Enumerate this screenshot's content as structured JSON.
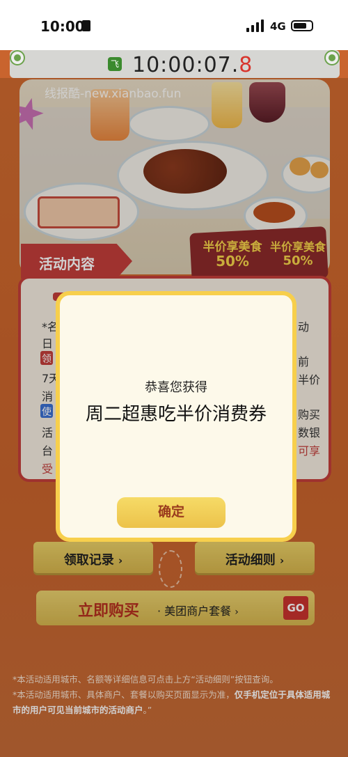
{
  "status_bar": {
    "time": "10:00",
    "network": "4G"
  },
  "clock": {
    "time_main": "10:00:07.",
    "time_frac": "8"
  },
  "watermark": "线报酷-new.xianbao.fun",
  "hero": {
    "section_title": "活动内容",
    "promo_a": {
      "line1": "半价享美食",
      "line2": "50%"
    },
    "promo_b": {
      "line1": "半价享美食",
      "line2": "50%"
    }
  },
  "card_fragments": {
    "left": [
      "*名",
      "日",
      "领",
      "7天",
      "消",
      "使",
      "活",
      "台",
      "受"
    ],
    "right": [
      "动",
      "前",
      "半价",
      "购买",
      "数银",
      "可享"
    ]
  },
  "modal": {
    "subtitle": "恭喜您获得",
    "title": "周二超惠吃半价消费券",
    "confirm_label": "确定"
  },
  "buttons": {
    "records": "领取记录",
    "rules": "活动细则",
    "buy_now": "立即购买",
    "buy_sub": "· 美团商户套餐",
    "go": "GO",
    "arrow": "›"
  },
  "notes": {
    "line1": "*本活动适用城市、名额等详细信息可点击上方“活动细则”按钮查询。",
    "line2_plain": "*本活动适用城市、具体商户、套餐以购买页面显示为准，",
    "line2_bold": "仅手机定位于具体适用城市的用户可见当前城市的活动商户",
    "line2_end": "。”"
  },
  "colors": {
    "accent_red": "#c23d3a",
    "gold": "#f7cf4c",
    "page_bg": "#c9642e"
  }
}
